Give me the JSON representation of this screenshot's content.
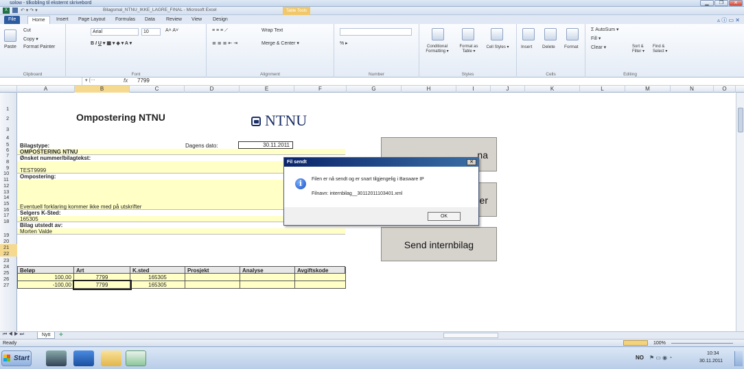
{
  "outer_window": {
    "title": "solow - tilkobling til eksternt skrivebord",
    "min": "▁",
    "max": "❐",
    "close": "✕"
  },
  "excel": {
    "title": "Bilagsmal_NTNU_IKKE_LAGRE_FINAL - Microsoft Excel",
    "table_tools": "Table Tools",
    "tabs": [
      "File",
      "Home",
      "Insert",
      "Page Layout",
      "Formulas",
      "Data",
      "Review",
      "View",
      "Design"
    ],
    "ribbon": {
      "clipboard": {
        "paste": "Paste",
        "cut": "Cut",
        "copy": "Copy ▾",
        "format_painter": "Format Painter",
        "label": "Clipboard"
      },
      "font": {
        "name": "Arial",
        "size": "10",
        "label": "Font"
      },
      "alignment": {
        "wrap": "Wrap Text",
        "merge": "Merge & Center ▾",
        "label": "Alignment"
      },
      "number": {
        "label": "Number",
        "format": "% ▸"
      },
      "styles": {
        "conditional": "Conditional Formatting ▾",
        "format_table": "Format as Table ▾",
        "cell": "Cell Styles ▾",
        "label": "Styles"
      },
      "cells": {
        "insert": "Insert",
        "delete": "Delete",
        "format": "Format",
        "label": "Cells"
      },
      "editing": {
        "autosum": "Σ AutoSum ▾",
        "fill": "Fill ▾",
        "clear": "Clear ▾",
        "sort": "Sort & Filter ▾",
        "find": "Find & Select ▾",
        "label": "Editing"
      }
    },
    "formula_bar": {
      "fx": "fx",
      "value": "7799"
    },
    "columns": [
      "A",
      "B",
      "C",
      "D",
      "E",
      "F",
      "G",
      "H",
      "I",
      "J",
      "K",
      "L",
      "M",
      "N",
      "O"
    ],
    "rows": [
      "1",
      "2",
      "3",
      "4",
      "5",
      "6",
      "7",
      "8",
      "9",
      "10",
      "11",
      "12",
      "13",
      "14",
      "15",
      "16",
      "17",
      "18",
      "19",
      "20",
      "21",
      "22",
      "23",
      "24",
      "25",
      "26",
      "27"
    ],
    "sheet": {
      "logo": "NTNU",
      "heading": "Ompostering NTNU",
      "bilagstype_label": "Bilagstype:",
      "bilagstype_value": "OMPOSTERING NTNU",
      "dato_label": "Dagens dato:",
      "dato_value": "30.11.2011",
      "onsket_label": "Ønsket nummer/bilagtekst:",
      "onsket_value": "TEST9999",
      "ompostering_label": "Ompostering:",
      "forklaring": "Eventuell forklaring kommer ikke med på utskrifter",
      "selger_label": "Selgers K-Sted:",
      "selger_value": "165305",
      "utstedt_label": "Bilag utstedt av:",
      "utstedt_value": "Morten Valde",
      "table": {
        "headers": [
          "Beløp",
          "Art",
          "K.sted",
          "Prosjekt",
          "Analyse",
          "Avgiftskode"
        ],
        "rows": [
          [
            "100,00",
            "7799",
            "165305",
            "",
            "",
            ""
          ],
          [
            "-100,00",
            "7799",
            "165305",
            "",
            "",
            ""
          ]
        ]
      },
      "buttons": {
        "b1": "…na",
        "b2": "…jer",
        "send": "Send internbilag"
      }
    },
    "sheet_tab": "Nytt",
    "status": {
      "ready": "Ready",
      "zoom": "100%"
    }
  },
  "dialog": {
    "title": "Fil sendt",
    "message": "Filen er nå sendt og er snart tilgjengelig i Basware IP",
    "filename": "Filnavn: internbilag__30112011103401.xml",
    "ok": "OK",
    "close": "✕"
  },
  "taskbar": {
    "start": "Start",
    "lang": "NO",
    "time": "10:34",
    "date": "30.11.2011"
  }
}
